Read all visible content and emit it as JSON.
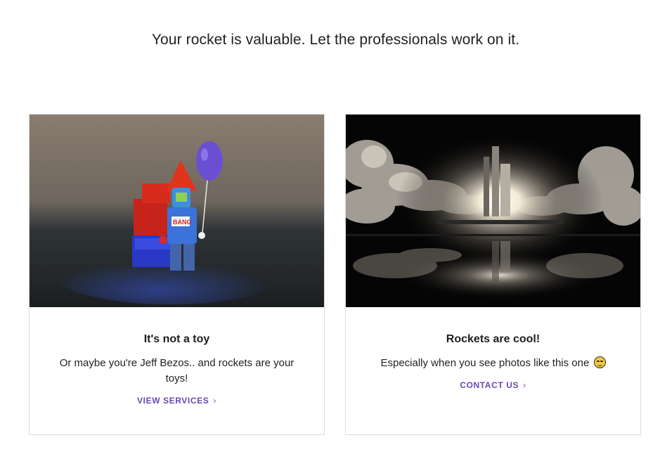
{
  "headline": "Your rocket is valuable. Let the professionals work on it.",
  "cards": [
    {
      "image": "lego-rocket-minifigure-with-balloon",
      "title": "It's not a toy",
      "text": "Or maybe you're Jeff Bezos.. and rockets are your toys!",
      "link_label": "VIEW SERVICES",
      "link_icon": "chevron-right-icon"
    },
    {
      "image": "rocket-launch-night-reflection",
      "title": "Rockets are cool!",
      "text": "Especially when you see photos like this one",
      "emoji": "smiling-face-icon",
      "link_label": "CONTACT US",
      "link_icon": "chevron-right-icon"
    }
  ],
  "colors": {
    "link": "#6d47b3",
    "card_border": "#dcdcdc",
    "text": "#222222"
  }
}
